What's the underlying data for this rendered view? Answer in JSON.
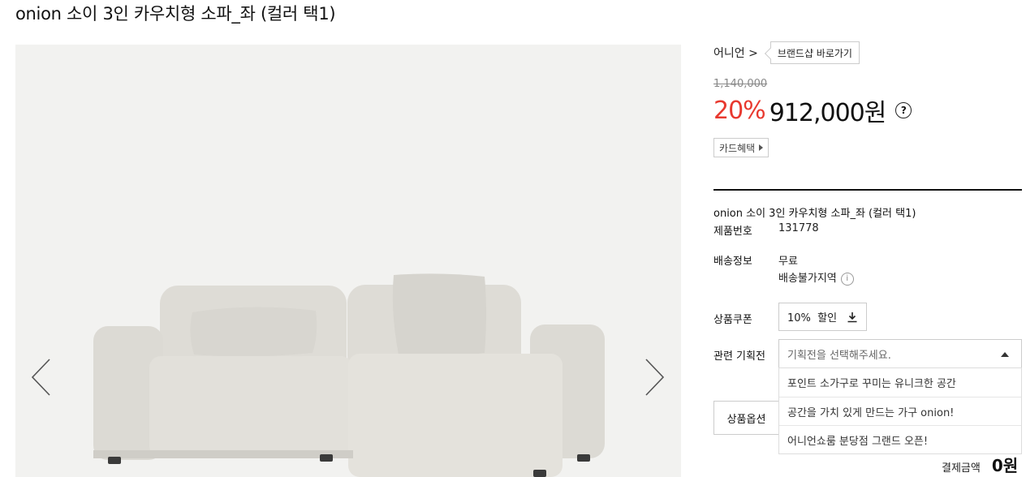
{
  "product": {
    "title": "onion 소이 3인 카우치형 소파_좌 (컬러 택1)"
  },
  "brand": {
    "name": "어니언 >",
    "shop_button": "브랜드샵 바로가기"
  },
  "price": {
    "original": "1,140,000",
    "discount": "20%",
    "sale": "912,000원",
    "help_icon": "?"
  },
  "card_benefit": "카드혜택",
  "info": {
    "product_name": "onion 소이 3인 카우치형 소파_좌 (컬러 택1)",
    "product_no_label": "제품번호",
    "product_no": "131778",
    "shipping_label": "배송정보",
    "shipping_value": "무료",
    "shipping_unavailable": "배송불가지역",
    "info_icon": "i",
    "coupon_label": "상품쿠폰",
    "coupon_value": "10%  할인",
    "promo_label": "관련 기획전",
    "promo_placeholder": "기획전을 선택해주세요.",
    "promo_options": [
      "포인트 소가구로 꾸미는 유니크한 공간",
      "공간을 가치 있게 만드는 가구 onion!",
      "어니언쇼룸 분당점 그랜드 오픈!"
    ],
    "option_tab": "상품옵션",
    "total_label": "결제금액",
    "total_value": "0원"
  },
  "colors": {
    "discount": "#e8392f",
    "gallery_bg": "#f2f2f0",
    "sofa": "#dcdad4"
  },
  "icons": {
    "prev": "chevron-left-icon",
    "next": "chevron-right-icon",
    "coupon": "download-icon",
    "card": "triangle-right-icon",
    "select": "caret-up-icon"
  }
}
